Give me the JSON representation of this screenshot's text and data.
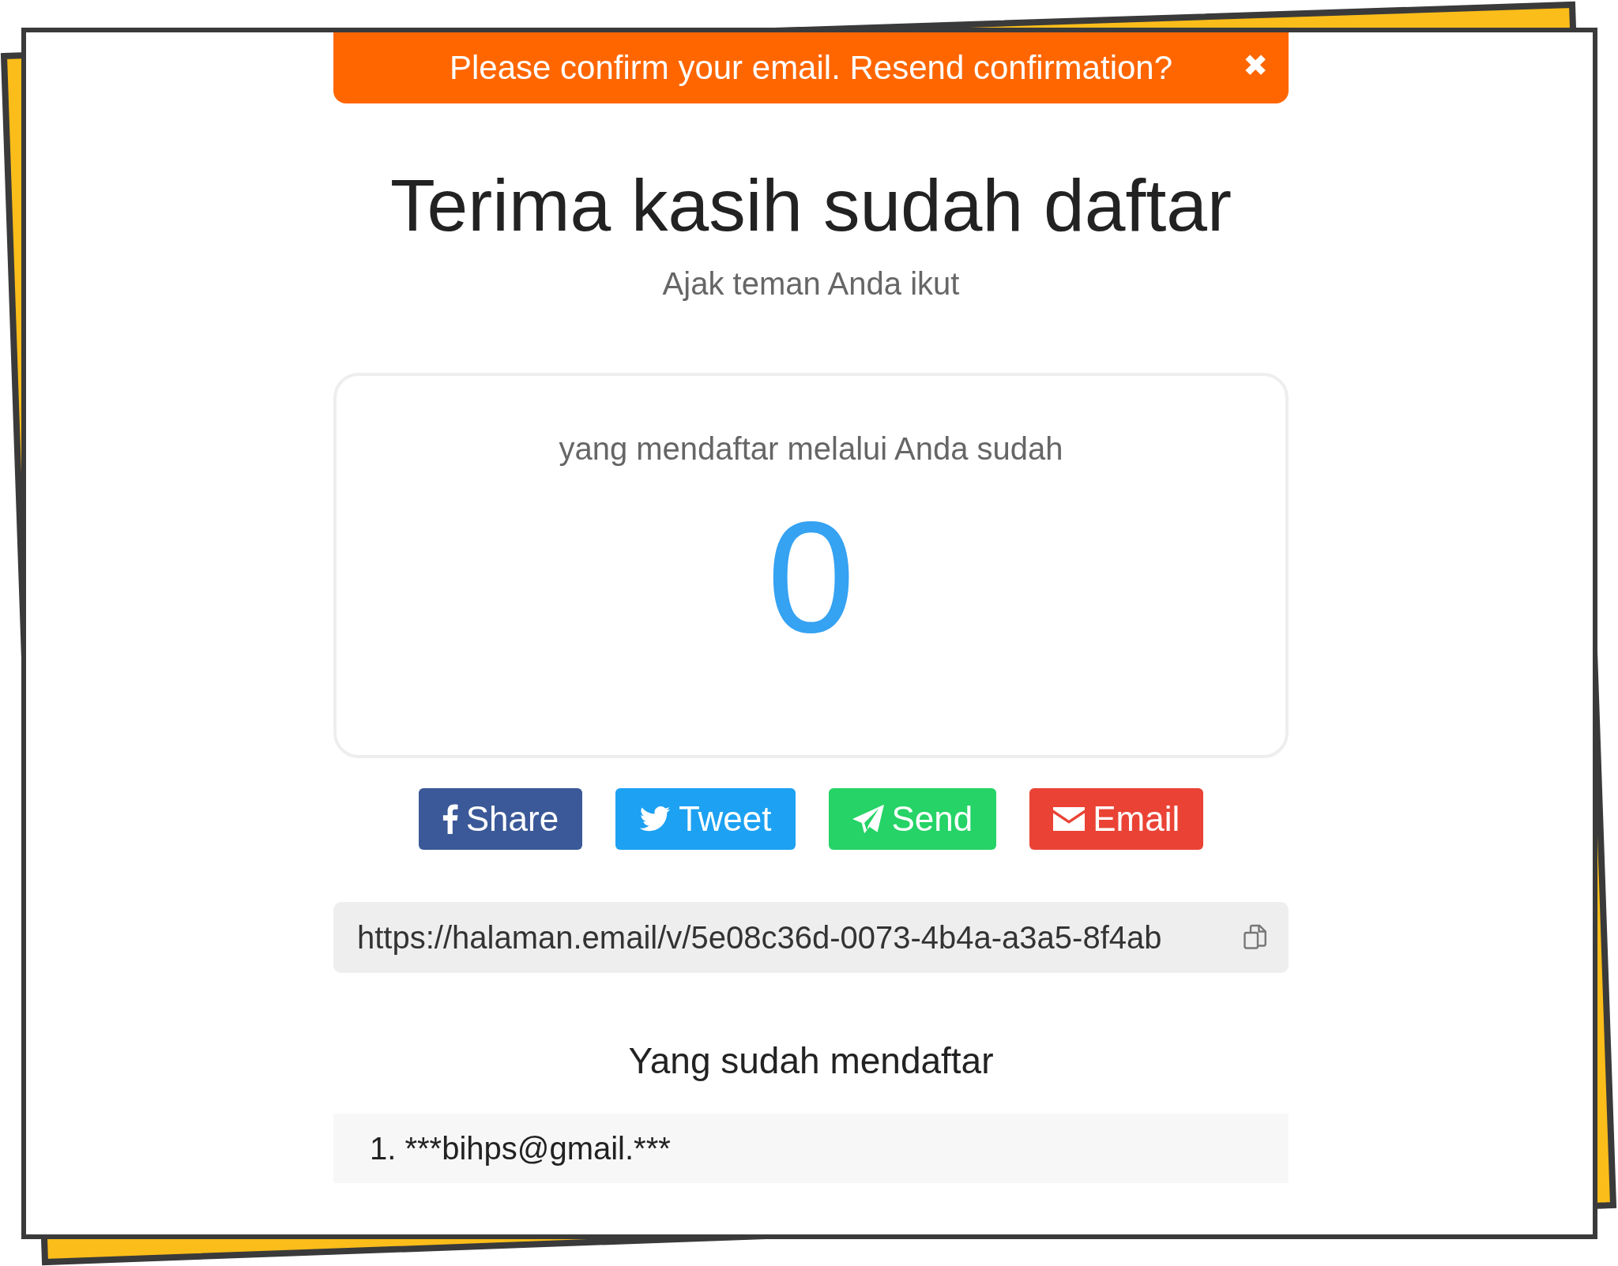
{
  "banner": {
    "message": "Please confirm your email. Resend confirmation?",
    "close": "✖"
  },
  "title": "Terima kasih sudah daftar",
  "subtitle": "Ajak teman Anda ikut",
  "counter": {
    "label": "yang mendaftar melalui Anda sudah",
    "value": "0"
  },
  "share_buttons": [
    {
      "kind": "facebook",
      "label": "Share",
      "color": "#3b5998"
    },
    {
      "kind": "twitter",
      "label": "Tweet",
      "color": "#1da1f2"
    },
    {
      "kind": "telegram",
      "label": "Send",
      "color": "#25d366"
    },
    {
      "kind": "email",
      "label": "Email",
      "color": "#ea4335"
    }
  ],
  "referral_link": {
    "value": "https://halaman.email/v/5e08c36d-0073-4b4a-a3a5-8f4ab"
  },
  "signups": {
    "heading": "Yang sudah mendaftar",
    "items": [
      "1. ***bihps@gmail.***"
    ]
  }
}
